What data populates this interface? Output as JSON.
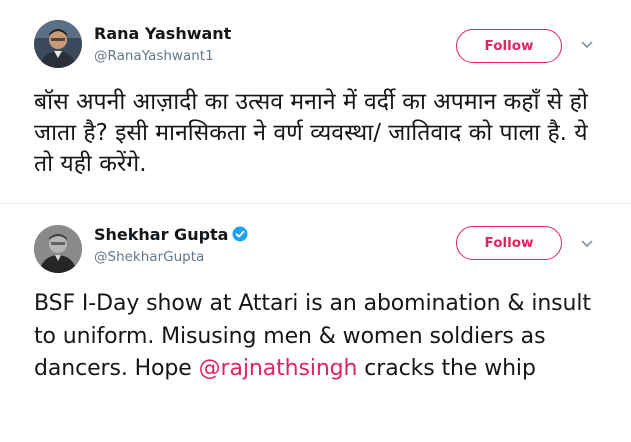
{
  "colors": {
    "accent": "#e0245e",
    "verified": "#1da1f2",
    "name_text": "#14171a",
    "secondary_text": "#657786",
    "divider": "#e6ecf0"
  },
  "tweets": [
    {
      "display_name": "Rana Yashwant",
      "handle": "@RanaYashwant1",
      "verified": false,
      "follow_label": "Follow",
      "avatar_icon": "user-avatar-photo",
      "caret_icon": "chevron-down-icon",
      "text": "बॉस अपनी आज़ादी का उत्सव मनाने में वर्दी का अपमान कहाँ से हो जाता है? इसी मानसिकता ने वर्ण व्यवस्था/ जातिवाद को पाला है. ये तो यही करेंगे."
    },
    {
      "display_name": "Shekhar Gupta",
      "handle": "@ShekharGupta",
      "verified": true,
      "verified_icon": "verified-badge-icon",
      "follow_label": "Follow",
      "avatar_icon": "user-avatar-photo",
      "caret_icon": "chevron-down-icon",
      "text_before": "BSF I-Day show at Attari is an abomination & insult to uniform. Misusing men & women soldiers as dancers. Hope ",
      "mention": "@rajnathsingh",
      "text_after": " cracks the whip"
    }
  ]
}
